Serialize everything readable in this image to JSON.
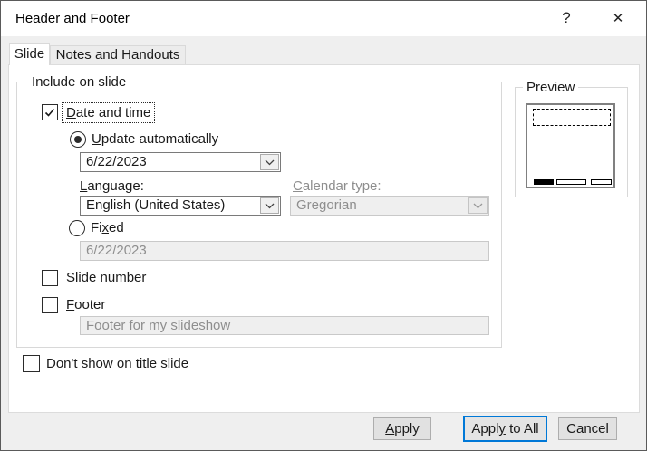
{
  "window": {
    "title": "Header and Footer",
    "help_glyph": "?",
    "close_glyph": "✕"
  },
  "tabs": {
    "slide": "Slide",
    "notes": "Notes and Handouts"
  },
  "include_group": {
    "legend": "Include on slide",
    "date_and_time": {
      "pre": "",
      "accel": "D",
      "post": "ate and time",
      "checked": true
    },
    "update_automatically": {
      "pre": "",
      "accel": "U",
      "post": "pdate automatically",
      "selected": true
    },
    "date_value": "6/22/2023",
    "language": {
      "pre": "",
      "accel": "L",
      "post": "anguage:",
      "value": "English (United States)"
    },
    "calendar_type": {
      "pre": "",
      "accel": "C",
      "post": "alendar type:",
      "value": "Gregorian",
      "disabled": true
    },
    "fixed": {
      "pre": "Fi",
      "accel": "x",
      "post": "ed",
      "selected": false,
      "value": "6/22/2023"
    },
    "slide_number": {
      "pre": "Slide ",
      "accel": "n",
      "post": "umber",
      "checked": false
    },
    "footer": {
      "pre": "",
      "accel": "F",
      "post": "ooter",
      "checked": false,
      "value": "Footer for my slideshow"
    }
  },
  "preview": {
    "legend": "Preview"
  },
  "dont_show": {
    "pre": "Don't show on title ",
    "accel": "s",
    "post": "lide",
    "checked": false
  },
  "buttons": {
    "apply": {
      "pre": "",
      "accel": "A",
      "post": "pply"
    },
    "apply_to_all": {
      "pre": "Appl",
      "accel": "y",
      "post": " to All"
    },
    "cancel": {
      "label": "Cancel"
    }
  }
}
